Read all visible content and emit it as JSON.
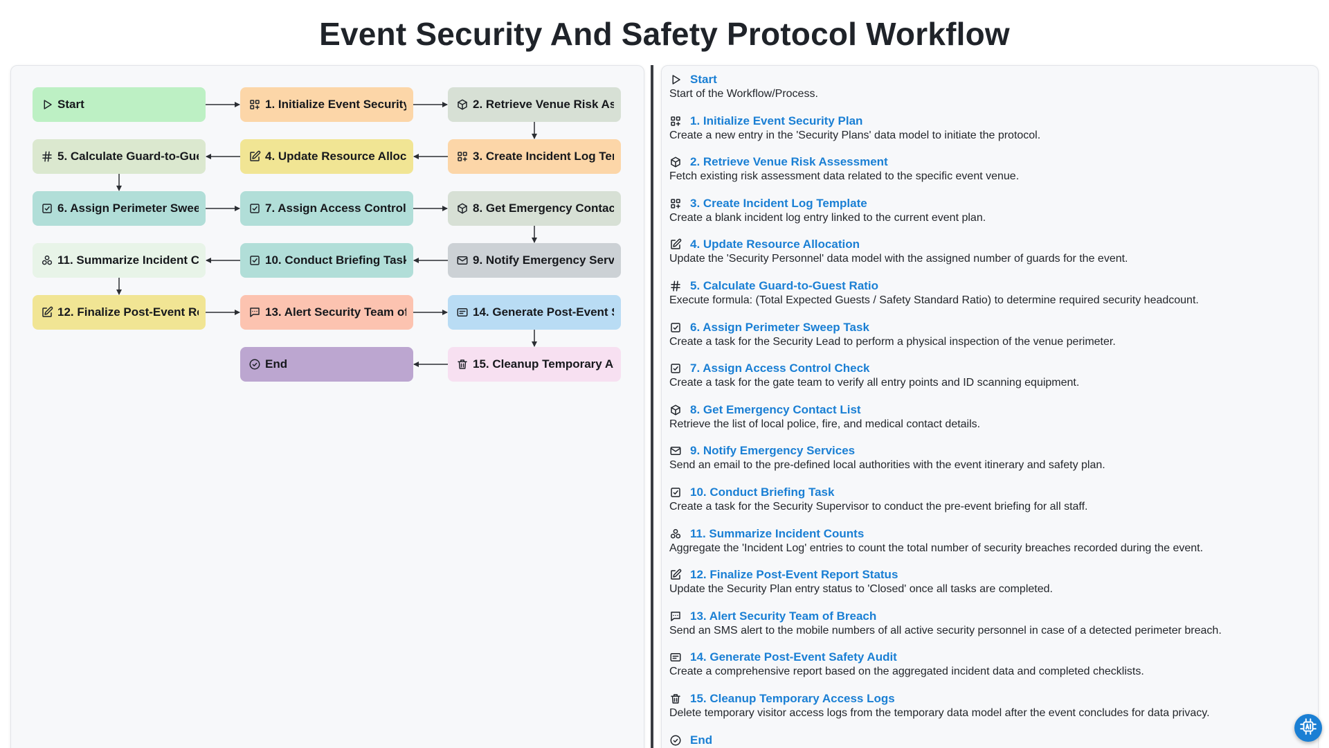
{
  "title": "Event Security And Safety Protocol Workflow",
  "colors": {
    "link": "#1a7fd4",
    "start": "#bdf0c4",
    "orange": "#fcd6a8",
    "sage": "#d7e0d5",
    "lime": "#dbe8cf",
    "yellow": "#f1e594",
    "teal": "#b1ded8",
    "mint": "#e8f4e8",
    "gray": "#ccd1d5",
    "salmon": "#fcc3b0",
    "blue": "#b9dcf4",
    "pink": "#f7e0f1",
    "purple": "#bca6d0"
  },
  "nodes": [
    {
      "id": "start",
      "label": "Start",
      "icon": "play-icon",
      "color": "#bdf0c4"
    },
    {
      "id": "n1",
      "label": "1. Initialize Event Security Plan",
      "icon": "grid-plus-icon",
      "color": "#fcd6a8"
    },
    {
      "id": "n2",
      "label": "2. Retrieve Venue Risk Assessment",
      "icon": "cube-icon",
      "color": "#d7e0d5"
    },
    {
      "id": "n3",
      "label": "3. Create Incident Log Template",
      "icon": "grid-plus-icon",
      "color": "#fcd6a8"
    },
    {
      "id": "n4",
      "label": "4. Update Resource Allocation",
      "icon": "edit-icon",
      "color": "#f1e594"
    },
    {
      "id": "n5",
      "label": "5. Calculate Guard-to-Guest Ratio",
      "icon": "hash-icon",
      "color": "#dbe8cf"
    },
    {
      "id": "n6",
      "label": "6. Assign Perimeter Sweep Task",
      "icon": "checkbox-icon",
      "color": "#b1ded8"
    },
    {
      "id": "n7",
      "label": "7. Assign Access Control Check",
      "icon": "checkbox-icon",
      "color": "#b1ded8"
    },
    {
      "id": "n8",
      "label": "8. Get Emergency Contact List",
      "icon": "cube-icon",
      "color": "#d7e0d5"
    },
    {
      "id": "n9",
      "label": "9. Notify Emergency Services",
      "icon": "mail-icon",
      "color": "#ccd1d5"
    },
    {
      "id": "n10",
      "label": "10. Conduct Briefing Task",
      "icon": "checkbox-icon",
      "color": "#b1ded8"
    },
    {
      "id": "n11",
      "label": "11. Summarize Incident Counts",
      "icon": "cluster-icon",
      "color": "#e8f4e8"
    },
    {
      "id": "n12",
      "label": "12. Finalize Post-Event Report Status",
      "icon": "edit-icon",
      "color": "#f1e594"
    },
    {
      "id": "n13",
      "label": "13. Alert Security Team of Breach",
      "icon": "message-icon",
      "color": "#fcc3b0"
    },
    {
      "id": "n14",
      "label": "14. Generate Post-Event Safety Audit",
      "icon": "report-icon",
      "color": "#b9dcf4"
    },
    {
      "id": "n15",
      "label": "15. Cleanup Temporary Access Logs",
      "icon": "trash-icon",
      "color": "#f7e0f1"
    },
    {
      "id": "end",
      "label": "End",
      "icon": "check-circle-icon",
      "color": "#bca6d0"
    }
  ],
  "edges": [
    [
      "start",
      "n1"
    ],
    [
      "n1",
      "n2"
    ],
    [
      "n2",
      "n3"
    ],
    [
      "n3",
      "n4"
    ],
    [
      "n4",
      "n5"
    ],
    [
      "n5",
      "n6"
    ],
    [
      "n6",
      "n7"
    ],
    [
      "n7",
      "n8"
    ],
    [
      "n8",
      "n9"
    ],
    [
      "n9",
      "n10"
    ],
    [
      "n10",
      "n11"
    ],
    [
      "n11",
      "n12"
    ],
    [
      "n12",
      "n13"
    ],
    [
      "n13",
      "n14"
    ],
    [
      "n14",
      "n15"
    ],
    [
      "n15",
      "end"
    ]
  ],
  "legend": [
    {
      "title": "Start",
      "icon": "play-icon",
      "desc": "Start of the Workflow/Process."
    },
    {
      "title": "1. Initialize Event Security Plan",
      "icon": "grid-plus-icon",
      "desc": "Create a new entry in the 'Security Plans' data model to initiate the protocol."
    },
    {
      "title": "2. Retrieve Venue Risk Assessment",
      "icon": "cube-icon",
      "desc": "Fetch existing risk assessment data related to the specific event venue."
    },
    {
      "title": "3. Create Incident Log Template",
      "icon": "grid-plus-icon",
      "desc": "Create a blank incident log entry linked to the current event plan."
    },
    {
      "title": "4. Update Resource Allocation",
      "icon": "edit-icon",
      "desc": "Update the 'Security Personnel' data model with the assigned number of guards for the event."
    },
    {
      "title": "5. Calculate Guard-to-Guest Ratio",
      "icon": "hash-icon",
      "desc": "Execute formula: (Total Expected Guests / Safety Standard Ratio) to determine required security headcount."
    },
    {
      "title": "6. Assign Perimeter Sweep Task",
      "icon": "checkbox-icon",
      "desc": "Create a task for the Security Lead to perform a physical inspection of the venue perimeter."
    },
    {
      "title": "7. Assign Access Control Check",
      "icon": "checkbox-icon",
      "desc": "Create a task for the gate team to verify all entry points and ID scanning equipment."
    },
    {
      "title": "8. Get Emergency Contact List",
      "icon": "cube-icon",
      "desc": "Retrieve the list of local police, fire, and medical contact details."
    },
    {
      "title": "9. Notify Emergency Services",
      "icon": "mail-icon",
      "desc": "Send an email to the pre-defined local authorities with the event itinerary and safety plan."
    },
    {
      "title": "10. Conduct Briefing Task",
      "icon": "checkbox-icon",
      "desc": "Create a task for the Security Supervisor to conduct the pre-event briefing for all staff."
    },
    {
      "title": "11. Summarize Incident Counts",
      "icon": "cluster-icon",
      "desc": "Aggregate the 'Incident Log' entries to count the total number of security breaches recorded during the event."
    },
    {
      "title": "12. Finalize Post-Event Report Status",
      "icon": "edit-icon",
      "desc": "Update the Security Plan entry status to 'Closed' once all tasks are completed."
    },
    {
      "title": "13. Alert Security Team of Breach",
      "icon": "message-icon",
      "desc": "Send an SMS alert to the mobile numbers of all active security personnel in case of a detected perimeter breach."
    },
    {
      "title": "14. Generate Post-Event Safety Audit",
      "icon": "report-icon",
      "desc": "Create a comprehensive report based on the aggregated incident data and completed checklists."
    },
    {
      "title": "15. Cleanup Temporary Access Logs",
      "icon": "trash-icon",
      "desc": "Delete temporary visitor access logs from the temporary data model after the event concludes for data privacy."
    },
    {
      "title": "End",
      "icon": "check-circle-icon",
      "desc": ""
    }
  ],
  "fab_icon": "ai-chip-icon"
}
